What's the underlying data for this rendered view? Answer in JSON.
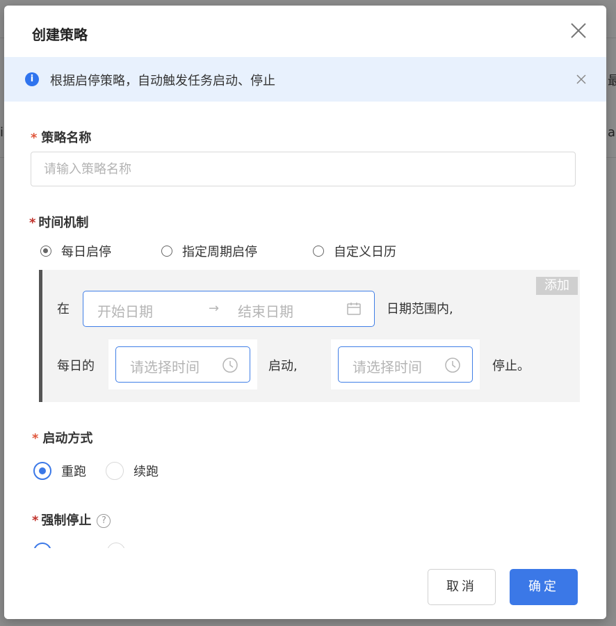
{
  "background": {
    "edge_text_1": "最",
    "edge_text_2": "a",
    "edge_text_left": "i"
  },
  "modal": {
    "title": "创建策略"
  },
  "alert": {
    "icon": "info-icon",
    "text": "根据启停策略，自动触发任务启动、停止"
  },
  "form": {
    "name_field": {
      "label": "策略名称",
      "required_mark": "*",
      "placeholder": "请输入策略名称",
      "value": ""
    },
    "time_mechanism": {
      "label": "时间机制",
      "required_mark": "*",
      "options": [
        "每日启停",
        "指定周期启停",
        "自定义日历"
      ],
      "selected": "每日启停"
    },
    "schedule": {
      "add_label": "添加",
      "prefix": "在",
      "start_placeholder": "开始日期",
      "range_separator": "→",
      "end_placeholder": "结束日期",
      "range_suffix": "日期范围内,",
      "daily_prefix": "每日的",
      "start_time_placeholder": "请选择时间",
      "start_suffix": "启动,",
      "stop_time_placeholder": "请选择时间",
      "stop_suffix": "停止。"
    },
    "start_mode": {
      "label": "启动方式",
      "required_mark": "*",
      "options": [
        "重跑",
        "续跑"
      ],
      "selected": "重跑"
    },
    "force_stop": {
      "label": "强制停止",
      "required_mark": "*",
      "help_icon": "?"
    }
  },
  "footer": {
    "cancel_label": "取消",
    "ok_label": "确定"
  },
  "colors": {
    "primary": "#3b78e7",
    "alert_bg": "#e8f1fd",
    "required": "#e0563b"
  }
}
